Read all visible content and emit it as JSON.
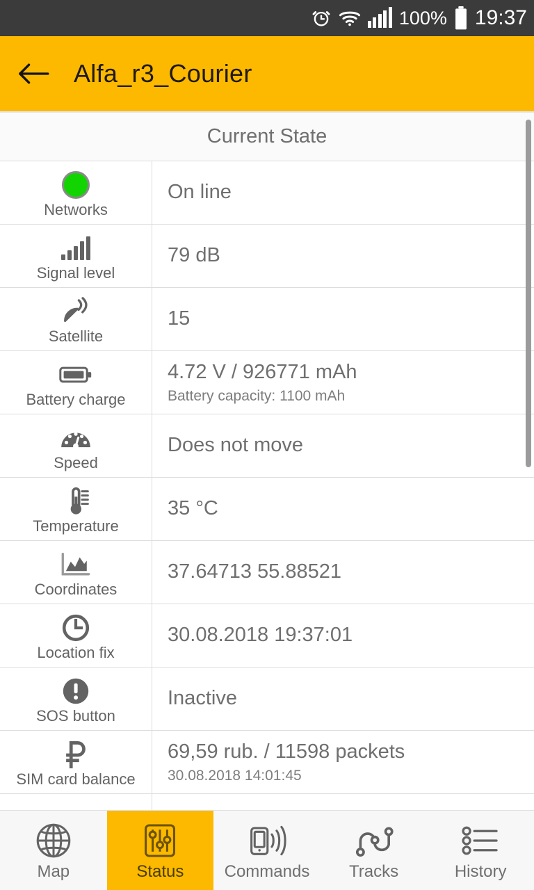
{
  "statusbar": {
    "alarm_icon": "alarm-clock-icon",
    "wifi_icon": "wifi-icon",
    "signal_icon": "cellular-signal-icon",
    "battery_percent": "100%",
    "battery_icon": "battery-full-icon",
    "clock": "19:37"
  },
  "appbar": {
    "back_icon": "back-arrow-icon",
    "title": "Alfa_r3_Courier",
    "bg_color": "#fcb900"
  },
  "content": {
    "section_title": "Current State",
    "rows": [
      {
        "icon": "green-status-dot-icon",
        "label": "Networks",
        "value": "On line",
        "sub": ""
      },
      {
        "icon": "signal-bars-icon",
        "label": "Signal level",
        "value": "79 dB",
        "sub": ""
      },
      {
        "icon": "satellite-dish-icon",
        "label": "Satellite",
        "value": "15",
        "sub": ""
      },
      {
        "icon": "battery-icon",
        "label": "Battery charge",
        "value": "4.72 V / 926771 mAh",
        "sub": "Battery capacity: 1100 mAh"
      },
      {
        "icon": "speedometer-icon",
        "label": "Speed",
        "value": "Does not move",
        "sub": ""
      },
      {
        "icon": "thermometer-icon",
        "label": "Temperature",
        "value": "35 °C",
        "sub": ""
      },
      {
        "icon": "coordinates-chart-icon",
        "label": "Coordinates",
        "value": "37.64713  55.88521",
        "sub": ""
      },
      {
        "icon": "clock-icon",
        "label": "Location fix",
        "value": "30.08.2018 19:37:01",
        "sub": ""
      },
      {
        "icon": "exclamation-circle-icon",
        "label": "SOS button",
        "value": "Inactive",
        "sub": ""
      },
      {
        "icon": "ruble-sign-icon",
        "label": "SIM card balance",
        "value": "69,59 rub. / 11598 packets",
        "sub": "30.08.2018 14:01:45"
      },
      {
        "icon": "t1-sensor-icon",
        "label": "",
        "value": "",
        "sub": ""
      }
    ]
  },
  "bottomnav": {
    "items": [
      {
        "icon": "globe-icon",
        "label": "Map",
        "active": false
      },
      {
        "icon": "sliders-icon",
        "label": "Status",
        "active": true
      },
      {
        "icon": "phone-wave-icon",
        "label": "Commands",
        "active": false
      },
      {
        "icon": "route-icon",
        "label": "Tracks",
        "active": false
      },
      {
        "icon": "list-icon",
        "label": "History",
        "active": false
      }
    ]
  }
}
